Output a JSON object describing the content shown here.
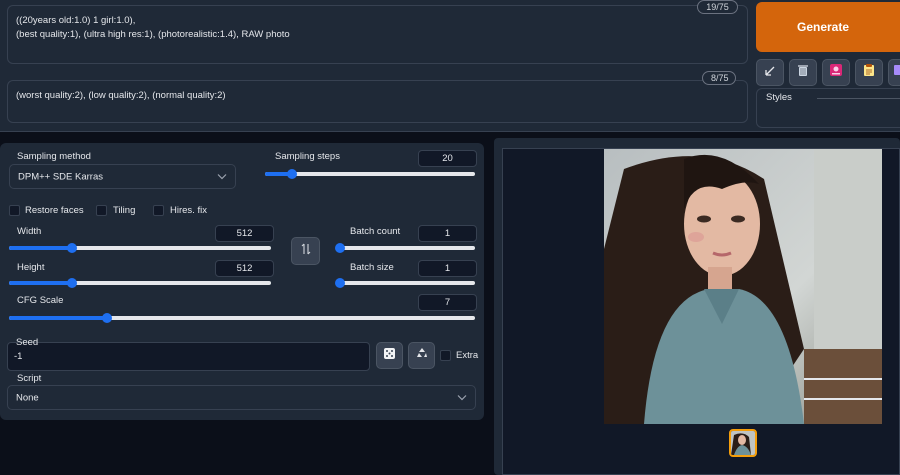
{
  "prompt": {
    "positive_text": "((20years old:1.0) 1 girl:1.0),\n(best quality:1), (ultra high res:1), (photorealistic:1.4), RAW photo",
    "positive_counter": "19/75",
    "negative_text": "(worst quality:2), (low quality:2), (normal quality:2)",
    "negative_counter": "8/75"
  },
  "actions": {
    "generate_label": "Generate",
    "tool_icons": [
      "arrow-diagonal-icon",
      "trash-icon",
      "image-card-icon",
      "clipboard-icon",
      "extra-networks-icon"
    ],
    "styles_label": "Styles"
  },
  "settings": {
    "sampling_method_label": "Sampling method",
    "sampling_method_value": "DPM++ SDE Karras",
    "sampling_steps_label": "Sampling steps",
    "sampling_steps_value": "20",
    "sampling_steps_fraction": 0.13,
    "restore_faces_label": "Restore faces",
    "tiling_label": "Tiling",
    "hires_fix_label": "Hires. fix",
    "width_label": "Width",
    "width_value": "512",
    "width_fraction": 0.24,
    "height_label": "Height",
    "height_value": "512",
    "height_fraction": 0.24,
    "batch_count_label": "Batch count",
    "batch_count_value": "1",
    "batch_count_fraction": 0.0,
    "batch_size_label": "Batch size",
    "batch_size_value": "1",
    "batch_size_fraction": 0.0,
    "cfg_scale_label": "CFG Scale",
    "cfg_scale_value": "7",
    "cfg_scale_fraction": 0.21,
    "seed_label": "Seed",
    "seed_value": "-1",
    "extra_label": "Extra",
    "script_label": "Script",
    "script_value": "None",
    "swap_icon": "swap-arrows-icon"
  },
  "colors": {
    "accent": "#1e6ff1",
    "generate": "#d4650c",
    "panel": "#1f2937",
    "background": "#0b0f19"
  }
}
